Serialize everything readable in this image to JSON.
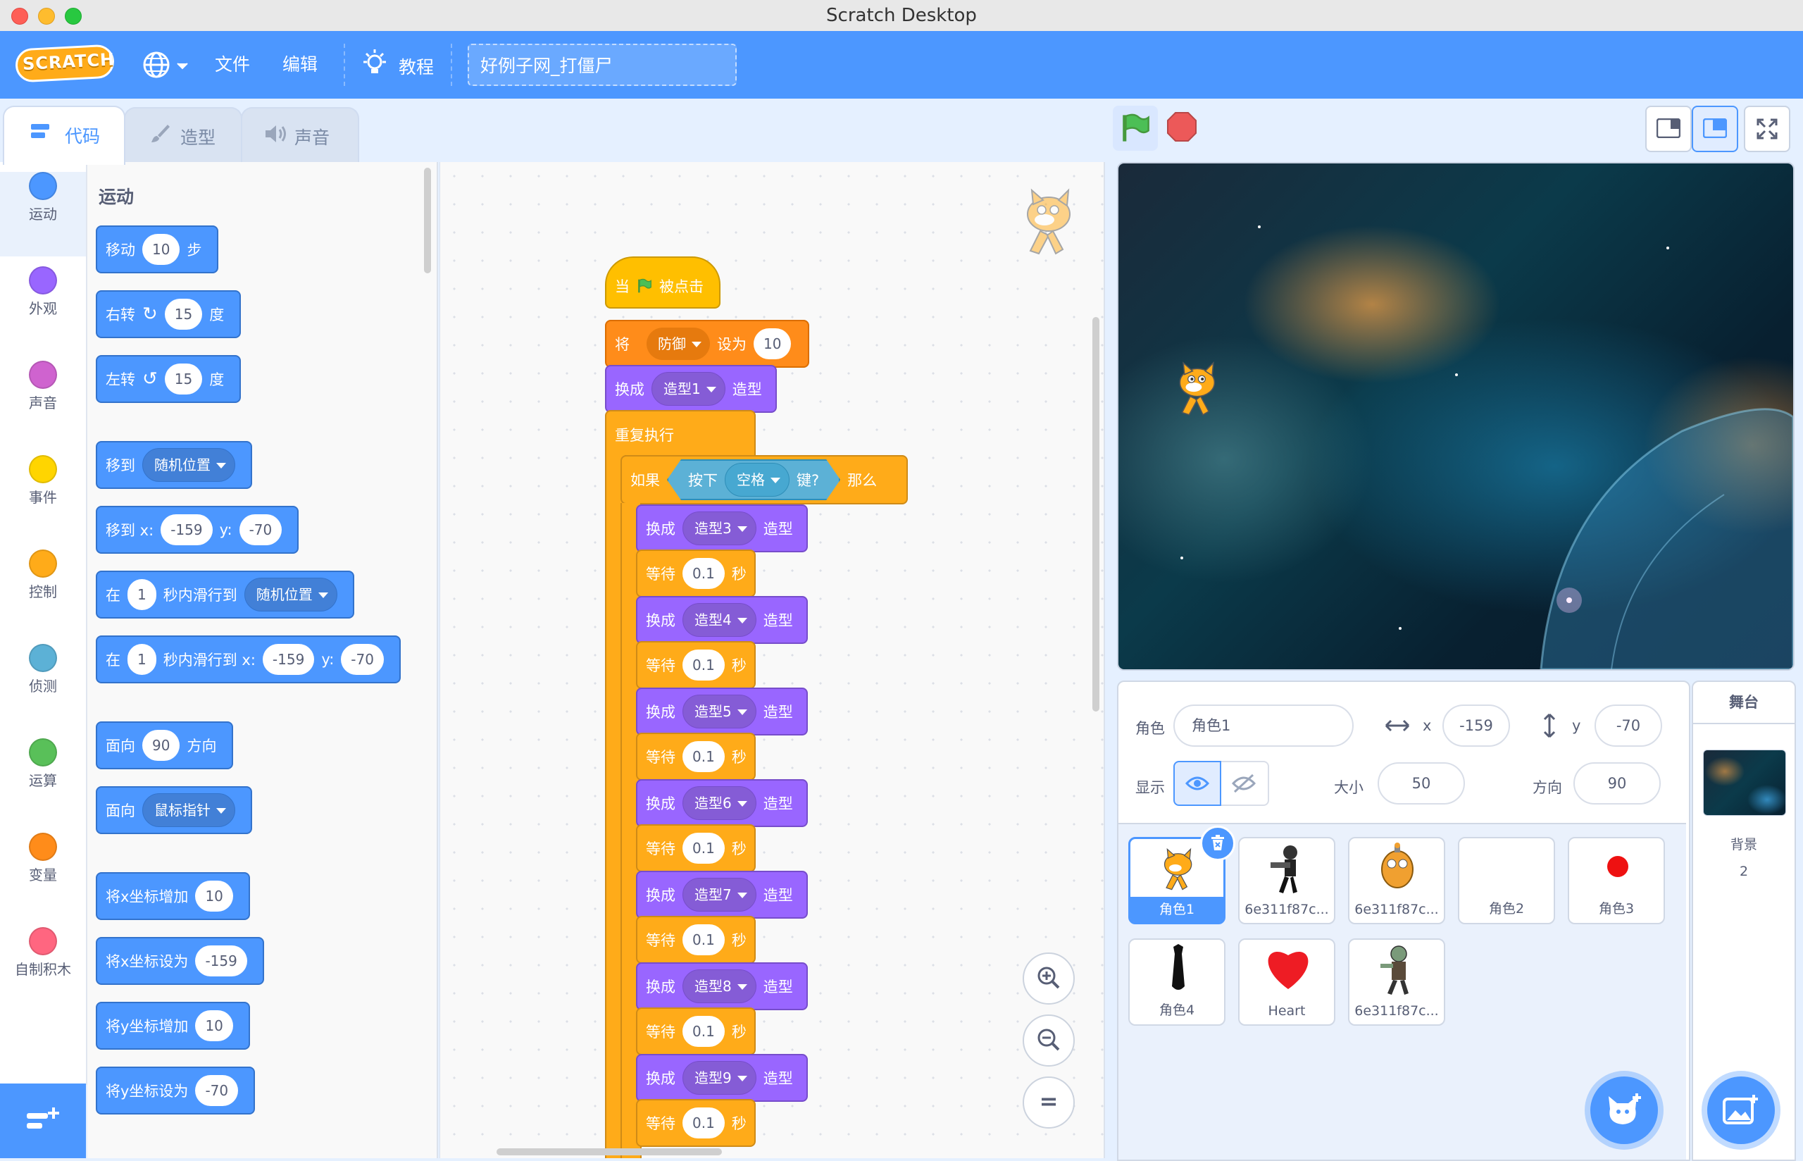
{
  "window": {
    "title": "Scratch Desktop"
  },
  "menubar": {
    "logo": "SCRATCH",
    "file": "文件",
    "edit": "编辑",
    "tutorials": "教程",
    "project_title": "好例子网_打僵尸"
  },
  "tabs": [
    {
      "label": "代码",
      "active": true,
      "icon": "code-icon"
    },
    {
      "label": "造型",
      "active": false,
      "icon": "brush-icon"
    },
    {
      "label": "声音",
      "active": false,
      "icon": "speaker-icon"
    }
  ],
  "categories": [
    {
      "label": "运动",
      "color": "#4c97ff"
    },
    {
      "label": "外观",
      "color": "#9966ff"
    },
    {
      "label": "声音",
      "color": "#cf63cf"
    },
    {
      "label": "事件",
      "color": "#ffd500"
    },
    {
      "label": "控制",
      "color": "#ffab19"
    },
    {
      "label": "侦测",
      "color": "#5cb1d6"
    },
    {
      "label": "运算",
      "color": "#59c059"
    },
    {
      "label": "变量",
      "color": "#ff8c1a"
    },
    {
      "label": "自制积木",
      "color": "#ff6680"
    }
  ],
  "palette": {
    "section_title": "运动",
    "move": {
      "t1": "移动",
      "v": "10",
      "t2": "步"
    },
    "turn_right": {
      "t1": "右转",
      "v": "15",
      "t2": "度"
    },
    "turn_left": {
      "t1": "左转",
      "v": "15",
      "t2": "度"
    },
    "goto": {
      "t1": "移到",
      "d": "随机位置"
    },
    "goto_xy": {
      "t1": "移到 x:",
      "x": "-159",
      "t2": "y:",
      "y": "-70"
    },
    "glide": {
      "t1": "在",
      "v": "1",
      "t2": "秒内滑行到",
      "d": "随机位置"
    },
    "glide_xy": {
      "t1": "在",
      "v": "1",
      "t2": "秒内滑行到 x:",
      "x": "-159",
      "t3": "y:",
      "y": "-70"
    },
    "point_dir": {
      "t1": "面向",
      "v": "90",
      "t2": "方向"
    },
    "point_towards": {
      "t1": "面向",
      "d": "鼠标指针"
    },
    "change_x": {
      "t1": "将x坐标增加",
      "v": "10"
    },
    "set_x": {
      "t1": "将x坐标设为",
      "v": "-159"
    },
    "change_y": {
      "t1": "将y坐标增加",
      "v": "10"
    },
    "set_y": {
      "t1": "将y坐标设为",
      "v": "-70"
    }
  },
  "script": {
    "hat": {
      "t1": "当",
      "t2": "被点击"
    },
    "set_var": {
      "t1": "将",
      "d": "防御",
      "t2": "设为",
      "v": "10"
    },
    "switch1": {
      "t1": "换成",
      "d": "造型1",
      "t2": "造型"
    },
    "forever": "重复执行",
    "if": {
      "t1": "如果",
      "s1": "按下",
      "sd": "空格",
      "s2": "键?",
      "t2": "那么"
    },
    "steps": [
      {
        "t1": "换成",
        "d": "造型3",
        "t2": "造型",
        "w1": "等待",
        "wv": "0.1",
        "w2": "秒"
      },
      {
        "t1": "换成",
        "d": "造型4",
        "t2": "造型",
        "w1": "等待",
        "wv": "0.1",
        "w2": "秒"
      },
      {
        "t1": "换成",
        "d": "造型5",
        "t2": "造型",
        "w1": "等待",
        "wv": "0.1",
        "w2": "秒"
      },
      {
        "t1": "换成",
        "d": "造型6",
        "t2": "造型",
        "w1": "等待",
        "wv": "0.1",
        "w2": "秒"
      },
      {
        "t1": "换成",
        "d": "造型7",
        "t2": "造型",
        "w1": "等待",
        "wv": "0.1",
        "w2": "秒"
      },
      {
        "t1": "换成",
        "d": "造型8",
        "t2": "造型",
        "w1": "等待",
        "wv": "0.1",
        "w2": "秒"
      },
      {
        "t1": "换成",
        "d": "造型9",
        "t2": "造型",
        "w1": "等待",
        "wv": "0.1",
        "w2": "秒"
      }
    ]
  },
  "zoom": {
    "in": "+",
    "out": "−",
    "reset": "="
  },
  "sprite_info": {
    "sprite_label": "角色",
    "sprite_name": "角色1",
    "x_label": "x",
    "x": "-159",
    "y_label": "y",
    "y": "-70",
    "show_label": "显示",
    "size_label": "大小",
    "size": "50",
    "direction_label": "方向",
    "direction": "90"
  },
  "sprites": [
    {
      "name": "角色1",
      "selected": true
    },
    {
      "name": "6e311f87c...",
      "selected": false
    },
    {
      "name": "6e311f87c...",
      "selected": false
    },
    {
      "name": "角色2",
      "selected": false
    },
    {
      "name": "角色3",
      "selected": false
    },
    {
      "name": "角色4",
      "selected": false
    },
    {
      "name": "Heart",
      "selected": false
    },
    {
      "name": "6e311f87c...",
      "selected": false
    }
  ],
  "stage_pane": {
    "title": "舞台",
    "backdrops_label": "背景",
    "backdrops_count": "2"
  },
  "colors": {
    "accent": "#4c97ff",
    "motion": "#4c97ff",
    "looks": "#9966ff",
    "control": "#ffab19",
    "events": "#ffbf00",
    "variables": "#ff8c1a",
    "sensing": "#5cb1d6"
  }
}
